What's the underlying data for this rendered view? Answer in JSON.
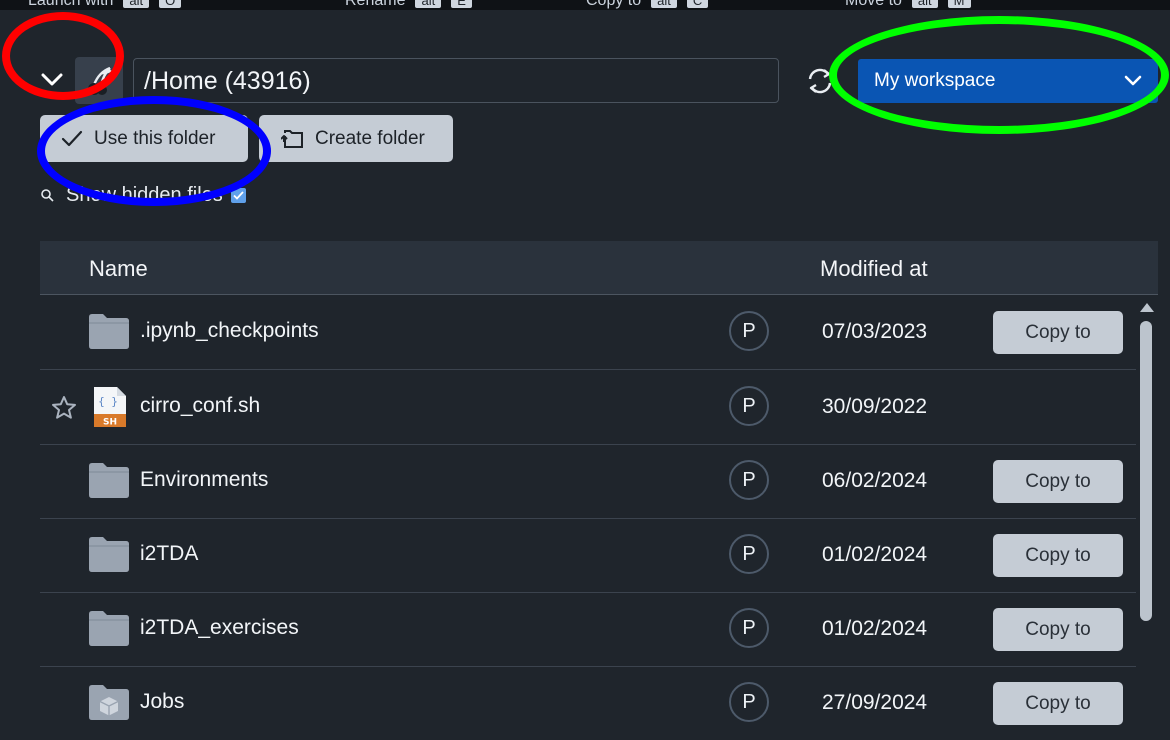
{
  "top_strip": {
    "items": [
      {
        "label": "Launch with",
        "key": "alt",
        "key2": "O"
      },
      {
        "label": "Rename",
        "key": "alt",
        "key2": "E"
      },
      {
        "label": "Copy to",
        "key": "alt",
        "key2": "C"
      },
      {
        "label": "Move to",
        "key": "alt",
        "key2": "M"
      }
    ]
  },
  "header": {
    "path": "/Home (43916)",
    "workspace": "My workspace"
  },
  "actions": {
    "use_folder": "Use this folder",
    "create_folder": "Create folder"
  },
  "options": {
    "show_hidden_label": "Show hidden files",
    "show_hidden_checked": true
  },
  "table": {
    "columns": {
      "name": "Name",
      "modified": "Modified at"
    },
    "rows": [
      {
        "name": ".ipynb_checkpoints",
        "type": "folder",
        "badge": "P",
        "date": "07/03/2023",
        "copy": "Copy to"
      },
      {
        "name": "cirro_conf.sh",
        "type": "sh-file",
        "icon_label": "SH",
        "badge": "P",
        "date": "30/09/2022",
        "copy": ""
      },
      {
        "name": "Environments",
        "type": "folder",
        "badge": "P",
        "date": "06/02/2024",
        "copy": "Copy to"
      },
      {
        "name": "i2TDA",
        "type": "folder",
        "badge": "P",
        "date": "01/02/2024",
        "copy": "Copy to"
      },
      {
        "name": "i2TDA_exercises",
        "type": "folder",
        "badge": "P",
        "date": "01/02/2024",
        "copy": "Copy to"
      },
      {
        "name": "Jobs",
        "type": "jobs-folder",
        "badge": "P",
        "date": "27/09/2024",
        "copy": "Copy to"
      }
    ]
  },
  "colors": {
    "background": "#1f252c",
    "accent": "#0a55b3",
    "button": "#c5ccd5",
    "annotation_red": "#ff0000",
    "annotation_blue": "#0000ff",
    "annotation_green": "#00ff00"
  }
}
